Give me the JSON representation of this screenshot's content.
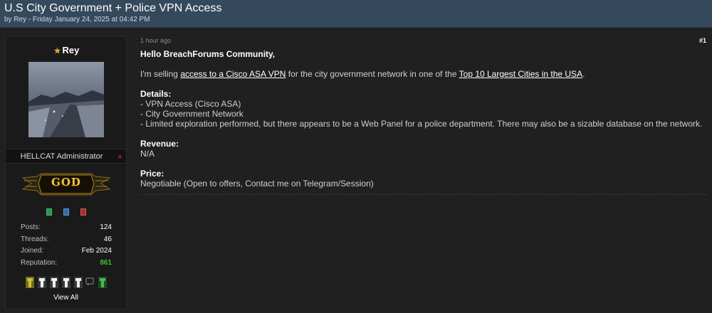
{
  "thread": {
    "title": "U.S City Government + Police VPN Access",
    "byline": "by Rey - Friday January 24, 2025 at 04:42 PM"
  },
  "author": {
    "username": "Rey",
    "user_title": "HELLCAT Administrator",
    "rank": "GOD",
    "stats": [
      {
        "label": "Posts:",
        "value": "124"
      },
      {
        "label": "Threads:",
        "value": "46"
      },
      {
        "label": "Joined:",
        "value": "Feb 2024"
      },
      {
        "label": "Reputation:",
        "value": "861"
      }
    ],
    "view_all": "View All"
  },
  "post": {
    "time": "1 hour ago",
    "number": "#1",
    "greeting": "Hello BreachForums Community,",
    "intro_prefix": "I'm selling ",
    "intro_link1": "access to a Cisco ASA VPN",
    "intro_middle": " for the city government network in one of the ",
    "intro_link2": "Top 10 Largest Cities in the USA",
    "intro_suffix": ".",
    "details_heading": "Details:",
    "details": [
      "- VPN Access (Cisco ASA)",
      "- City Government Network",
      "- Limited exploration performed, but there appears to be a Web Panel for a police department. There may also be a sizable database on the network."
    ],
    "revenue_heading": "Revenue:",
    "revenue_value": "N/A",
    "price_heading": "Price:",
    "price_value": "Negotiable (Open to offers, Contact me on Telegram/Session)"
  },
  "colors": {
    "header_bg": "#34495c",
    "page_bg": "#202020",
    "rank_gold": "#f0c233",
    "reputation_green": "#3cbf3c"
  }
}
